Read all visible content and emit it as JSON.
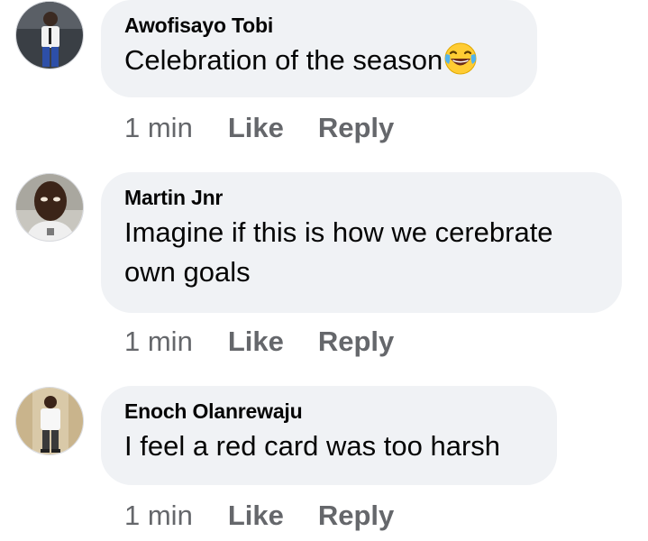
{
  "comments": [
    {
      "author": "Awofisayo Tobi",
      "text": "Celebration of the season",
      "emoji": "face-with-tears-of-joy",
      "time": "1 min",
      "like_label": "Like",
      "reply_label": "Reply"
    },
    {
      "author": "Martin Jnr",
      "text": "Imagine if this is how we cerebrate own goals",
      "time": "1 min",
      "like_label": "Like",
      "reply_label": "Reply"
    },
    {
      "author": "Enoch Olanrewaju",
      "text": "I feel a red card was too harsh",
      "time": "1 min",
      "like_label": "Like",
      "reply_label": "Reply"
    }
  ],
  "colors": {
    "bubble_bg": "#f0f2f5",
    "meta_text": "#65676b",
    "name_text": "#050505"
  }
}
